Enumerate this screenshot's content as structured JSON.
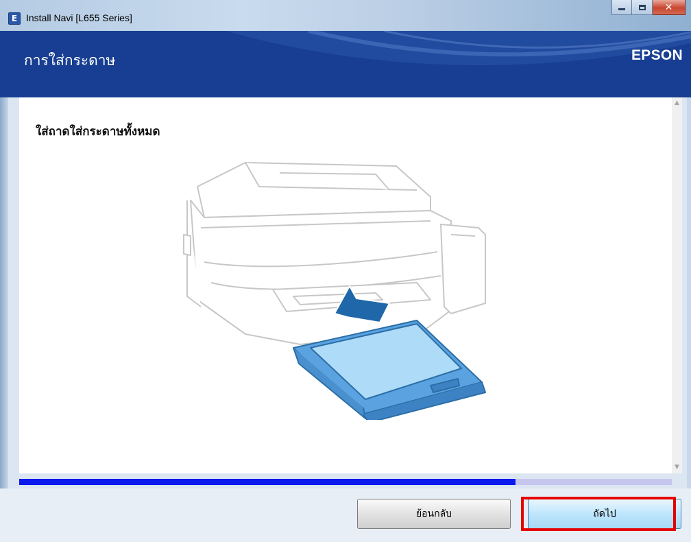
{
  "window": {
    "title": "Install Navi [L655 Series]",
    "app_icon_letter": "E",
    "controls": {
      "minimize": "minimize-icon",
      "maximize": "maximize-icon",
      "close": "close-icon"
    }
  },
  "header": {
    "title": "การใส่กระดาษ",
    "brand": "EPSON",
    "background_color": "#173e92"
  },
  "content": {
    "instruction": "ใส่ถาดใส่กระดาษทั้งหมด",
    "illustration": "printer-paper-cassette-illustration"
  },
  "progress": {
    "fraction": 0.76,
    "fill_color": "#0b18ee",
    "track_color": "#c6c6ee"
  },
  "footer": {
    "back_label": "ย้อนกลับ",
    "next_label": "ถัดไป",
    "highlight_color": "#e60000"
  }
}
